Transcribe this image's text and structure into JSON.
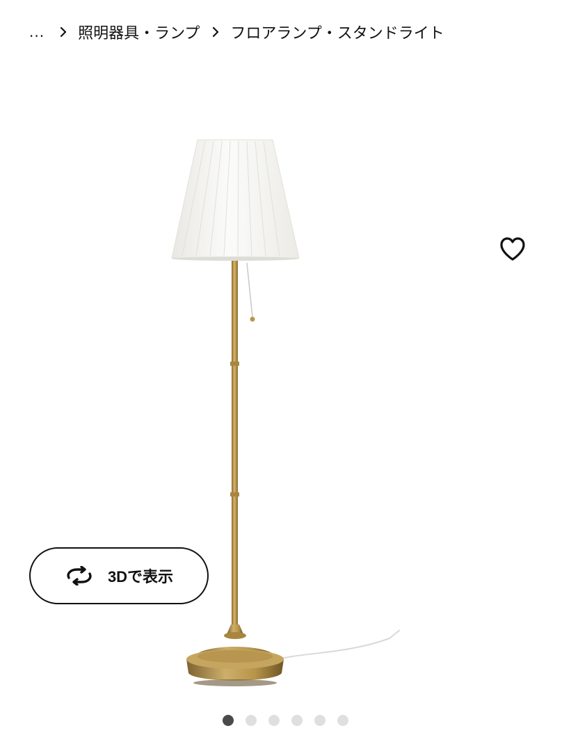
{
  "breadcrumb": {
    "ellipsis": "...",
    "items": [
      {
        "label": "照明器具・ランプ"
      },
      {
        "label": "フロアランプ・スタンドライト"
      }
    ]
  },
  "gallery": {
    "favorite_icon": "heart-outline-icon",
    "view3d_icon": "rotate-arrows-icon",
    "view3d_label": "3Dで表示",
    "slide_count": 6,
    "active_slide": 1
  },
  "colors": {
    "text": "#111111",
    "brass": "#b8954a",
    "shade": "#f4f3ef",
    "dot_active": "#4a4a4a",
    "dot_inactive": "#dfdfdf"
  }
}
